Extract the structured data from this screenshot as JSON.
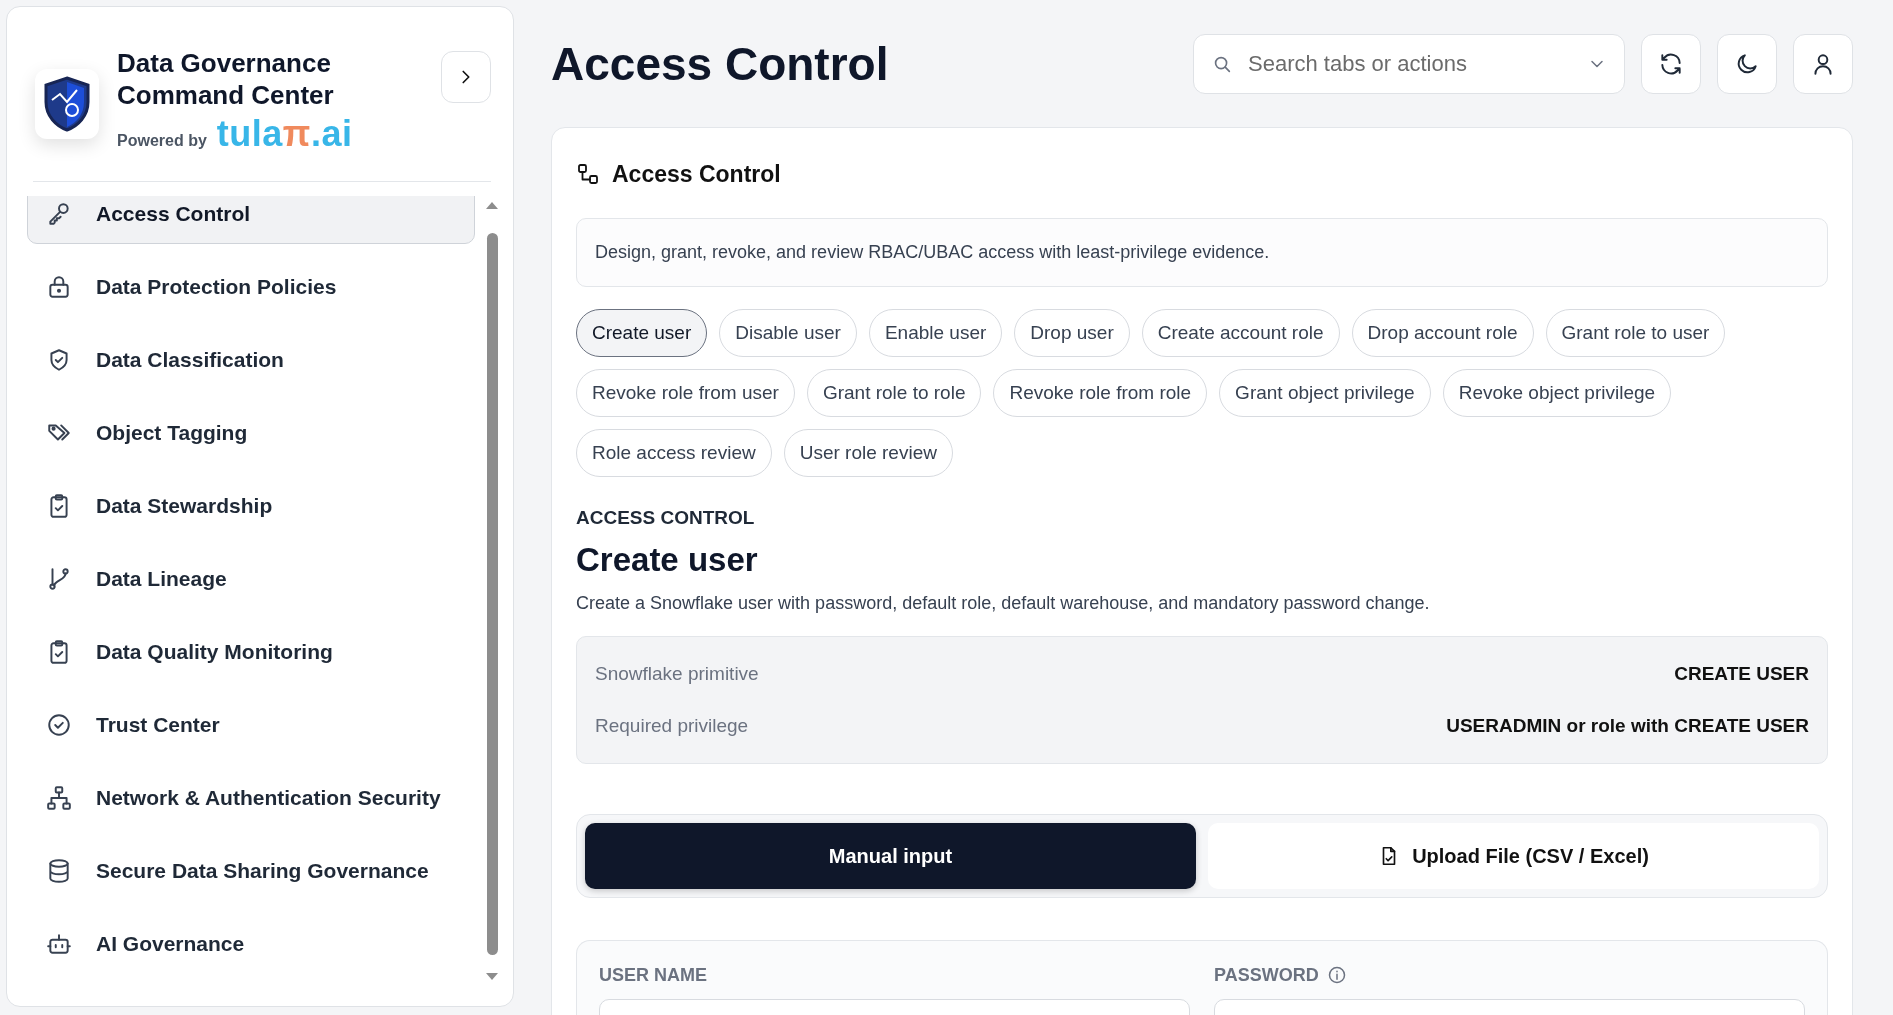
{
  "app": {
    "title": "Data Governance Command Center",
    "powered_by": "Powered by",
    "brand": [
      {
        "text": "tula",
        "accent": false
      },
      {
        "text": "π",
        "accent": true
      },
      {
        "text": ".ai",
        "accent": false
      }
    ]
  },
  "sidebar": {
    "items": [
      {
        "label": "Access Control",
        "selected": true
      },
      {
        "label": "Data Protection Policies",
        "selected": false
      },
      {
        "label": "Data Classification",
        "selected": false
      },
      {
        "label": "Object Tagging",
        "selected": false
      },
      {
        "label": "Data Stewardship",
        "selected": false
      },
      {
        "label": "Data Lineage",
        "selected": false
      },
      {
        "label": "Data Quality Monitoring",
        "selected": false
      },
      {
        "label": "Trust Center",
        "selected": false
      },
      {
        "label": "Network & Authentication Security",
        "selected": false
      },
      {
        "label": "Secure Data Sharing Governance",
        "selected": false
      },
      {
        "label": "AI Governance",
        "selected": false
      }
    ]
  },
  "page": {
    "title": "Access Control",
    "search": {
      "placeholder": "Search tabs or actions"
    }
  },
  "card": {
    "title": "Access Control",
    "description": "Design, grant, revoke, and review RBAC/UBAC access with least-privilege evidence.",
    "actions": [
      {
        "label": "Create user",
        "selected": true
      },
      {
        "label": "Disable user",
        "selected": false
      },
      {
        "label": "Enable user",
        "selected": false
      },
      {
        "label": "Drop user",
        "selected": false
      },
      {
        "label": "Create account role",
        "selected": false
      },
      {
        "label": "Drop account role",
        "selected": false
      },
      {
        "label": "Grant role to user",
        "selected": false
      },
      {
        "label": "Revoke role from user",
        "selected": false
      },
      {
        "label": "Grant role to role",
        "selected": false
      },
      {
        "label": "Revoke role from role",
        "selected": false
      },
      {
        "label": "Grant object privilege",
        "selected": false
      },
      {
        "label": "Revoke object privilege",
        "selected": false
      },
      {
        "label": "Role access review",
        "selected": false
      },
      {
        "label": "User role review",
        "selected": false
      }
    ],
    "section_label": "ACCESS CONTROL",
    "heading": "Create user",
    "subtitle": "Create a Snowflake user with password, default role, default warehouse, and mandatory password change.",
    "info": [
      {
        "label": "Snowflake primitive",
        "value": "CREATE USER"
      },
      {
        "label": "Required privilege",
        "value": "USERADMIN or role with CREATE USER"
      }
    ],
    "modes": [
      {
        "label": "Manual input",
        "selected": true,
        "kind": "plain"
      },
      {
        "label": "Upload File (CSV / Excel)",
        "selected": false,
        "kind": "file"
      }
    ],
    "fields": [
      {
        "label": "USER NAME",
        "info": false
      },
      {
        "label": "PASSWORD",
        "info": true
      }
    ]
  }
}
